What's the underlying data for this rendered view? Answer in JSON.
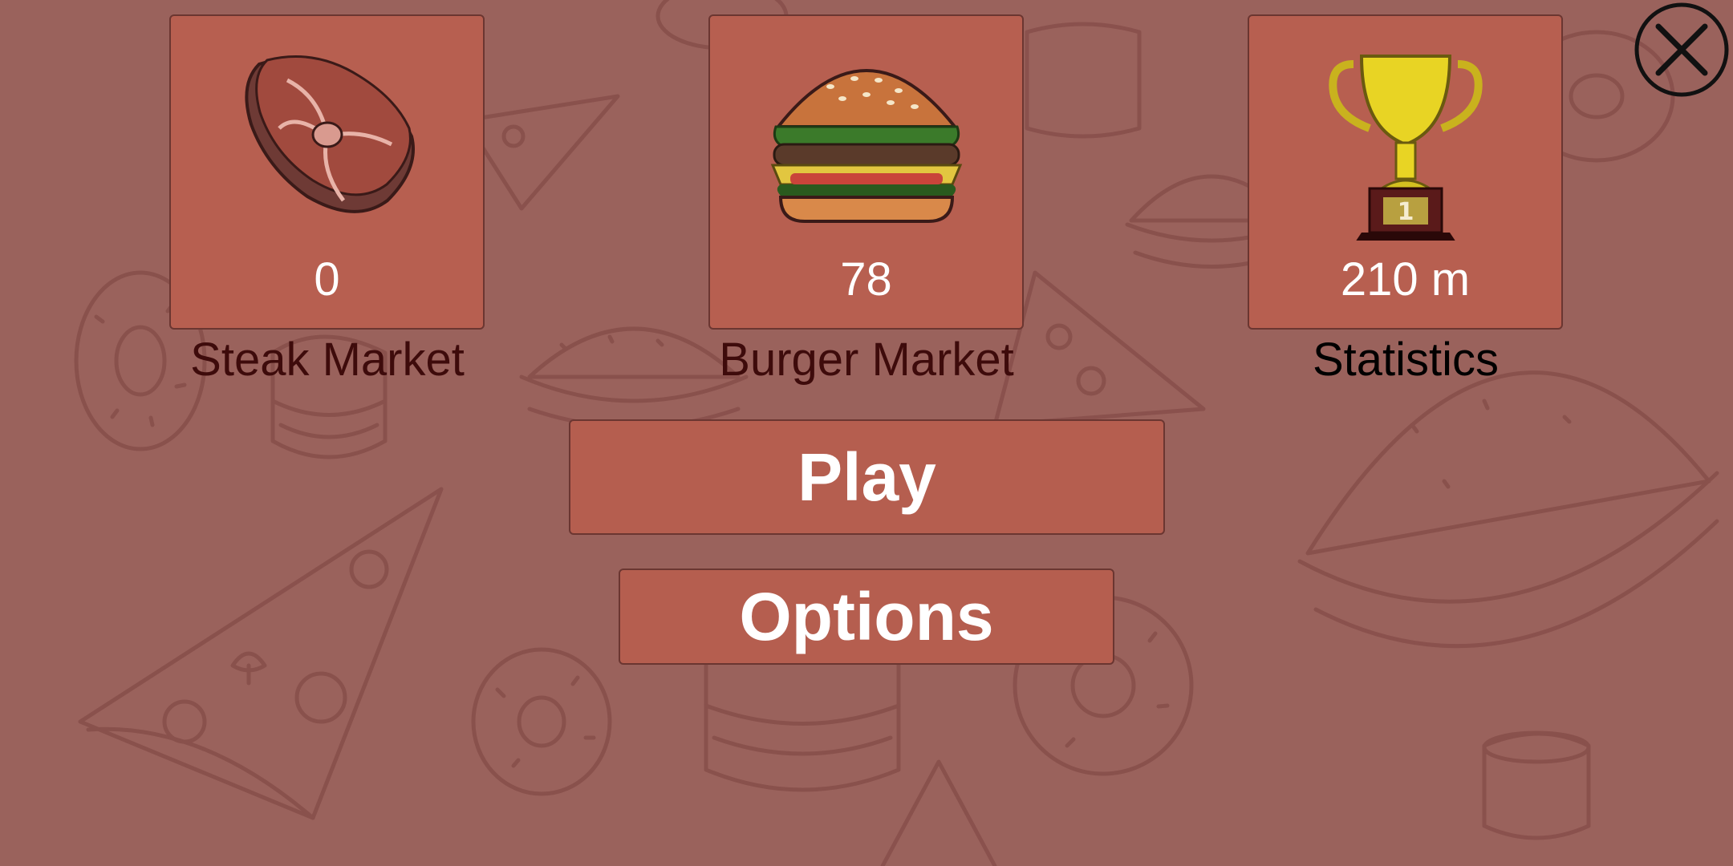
{
  "markets": [
    {
      "id": "steak",
      "value": "0",
      "label": "Steak Market",
      "icon": "steak-icon"
    },
    {
      "id": "burger",
      "value": "78",
      "label": "Burger Market",
      "icon": "burger-icon"
    },
    {
      "id": "statistics",
      "value": "210 m",
      "label": "Statistics",
      "icon": "trophy-icon"
    }
  ],
  "trophy_rank": "1",
  "buttons": {
    "play_label": "Play",
    "options_label": "Options"
  },
  "close_icon": "close-icon",
  "colors": {
    "background": "#9a625c",
    "card": "#b75f50",
    "market_label": "#3e0b0b",
    "statistics_label": "#000000",
    "value_text": "#ffffff"
  }
}
